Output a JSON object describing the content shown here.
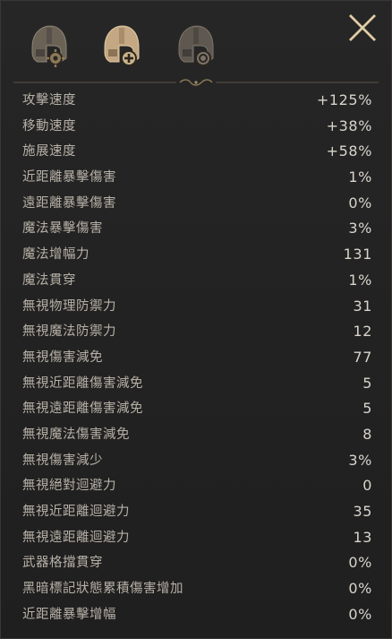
{
  "header": {
    "tabs": [
      {
        "icon": "helmet-gear-icon"
      },
      {
        "icon": "helmet-plus-icon"
      },
      {
        "icon": "helmet-shield-icon"
      }
    ],
    "close_icon": "close-icon"
  },
  "colors": {
    "background": "#232323",
    "label": "#b6b0a6",
    "value": "#d9d4cb",
    "accent_gold": "#c9b48a"
  },
  "stats": [
    {
      "label": "攻擊速度",
      "value": "+125%"
    },
    {
      "label": "移動速度",
      "value": "+38%"
    },
    {
      "label": "施展速度",
      "value": "+58%"
    },
    {
      "label": "近距離暴擊傷害",
      "value": "1%"
    },
    {
      "label": "遠距離暴擊傷害",
      "value": "0%"
    },
    {
      "label": "魔法暴擊傷害",
      "value": "3%"
    },
    {
      "label": "魔法增幅力",
      "value": "131"
    },
    {
      "label": "魔法貫穿",
      "value": "1%"
    },
    {
      "label": "無視物理防禦力",
      "value": "31"
    },
    {
      "label": "無視魔法防禦力",
      "value": "12"
    },
    {
      "label": "無視傷害減免",
      "value": "77"
    },
    {
      "label": "無視近距離傷害減免",
      "value": "5"
    },
    {
      "label": "無視遠距離傷害減免",
      "value": "5"
    },
    {
      "label": "無視魔法傷害減免",
      "value": "8"
    },
    {
      "label": "無視傷害減少",
      "value": "3%"
    },
    {
      "label": "無視絕對迴避力",
      "value": "0"
    },
    {
      "label": "無視近距離迴避力",
      "value": "35"
    },
    {
      "label": "無視遠距離迴避力",
      "value": "13"
    },
    {
      "label": "武器格擋貫穿",
      "value": "0%"
    },
    {
      "label": "黑暗標記狀態累積傷害增加",
      "value": "0%"
    },
    {
      "label": "近距離暴擊增幅",
      "value": "0%"
    }
  ]
}
